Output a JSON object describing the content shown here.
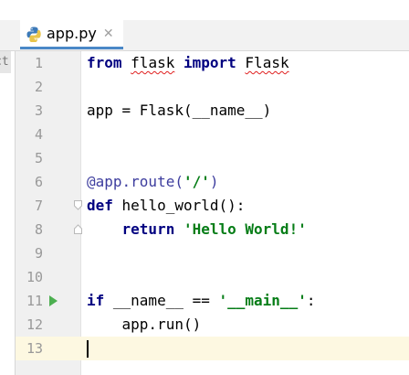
{
  "tab": {
    "label": "app.py",
    "close_glyph": "✕",
    "icon": "python-file-icon"
  },
  "side_strip": {
    "text": "ct"
  },
  "editor": {
    "current_line": 13,
    "lines": [
      {
        "num": "1",
        "tokens": [
          {
            "text": "from",
            "kind": "kw"
          },
          {
            "text": " ",
            "kind": "plain"
          },
          {
            "text": "flask",
            "kind": "squiggle"
          },
          {
            "text": " ",
            "kind": "plain"
          },
          {
            "text": "import",
            "kind": "kw"
          },
          {
            "text": " ",
            "kind": "plain"
          },
          {
            "text": "Flask",
            "kind": "squiggle"
          }
        ]
      },
      {
        "num": "2",
        "tokens": []
      },
      {
        "num": "3",
        "tokens": [
          {
            "text": "app = Flask(__name__)",
            "kind": "plain"
          }
        ]
      },
      {
        "num": "4",
        "tokens": []
      },
      {
        "num": "5",
        "tokens": []
      },
      {
        "num": "6",
        "tokens": [
          {
            "text": "@app.route(",
            "kind": "dec"
          },
          {
            "text": "'/'",
            "kind": "str"
          },
          {
            "text": ")",
            "kind": "dec"
          }
        ]
      },
      {
        "num": "7",
        "fold": true,
        "tokens": [
          {
            "text": "def",
            "kind": "kw"
          },
          {
            "text": " hello_world():",
            "kind": "plain"
          }
        ]
      },
      {
        "num": "8",
        "fold": true,
        "tokens": [
          {
            "text": "    ",
            "kind": "plain"
          },
          {
            "text": "return",
            "kind": "kw"
          },
          {
            "text": " ",
            "kind": "plain"
          },
          {
            "text": "'Hello World!'",
            "kind": "str"
          }
        ]
      },
      {
        "num": "9",
        "tokens": []
      },
      {
        "num": "10",
        "tokens": []
      },
      {
        "num": "11",
        "run": true,
        "tokens": [
          {
            "text": "if",
            "kind": "kw"
          },
          {
            "text": " __name__ == ",
            "kind": "plain"
          },
          {
            "text": "'__main__'",
            "kind": "str"
          },
          {
            "text": ":",
            "kind": "plain"
          }
        ]
      },
      {
        "num": "12",
        "tokens": [
          {
            "text": "    app.run()",
            "kind": "plain"
          }
        ]
      },
      {
        "num": "13",
        "tokens": []
      }
    ]
  },
  "colors": {
    "keyword": "#000080",
    "string": "#067d17",
    "decorator": "#3d3d9e",
    "current_line": "#fdf8e1",
    "run_icon": "#4caf50",
    "tab_underline": "#4a88c7"
  }
}
